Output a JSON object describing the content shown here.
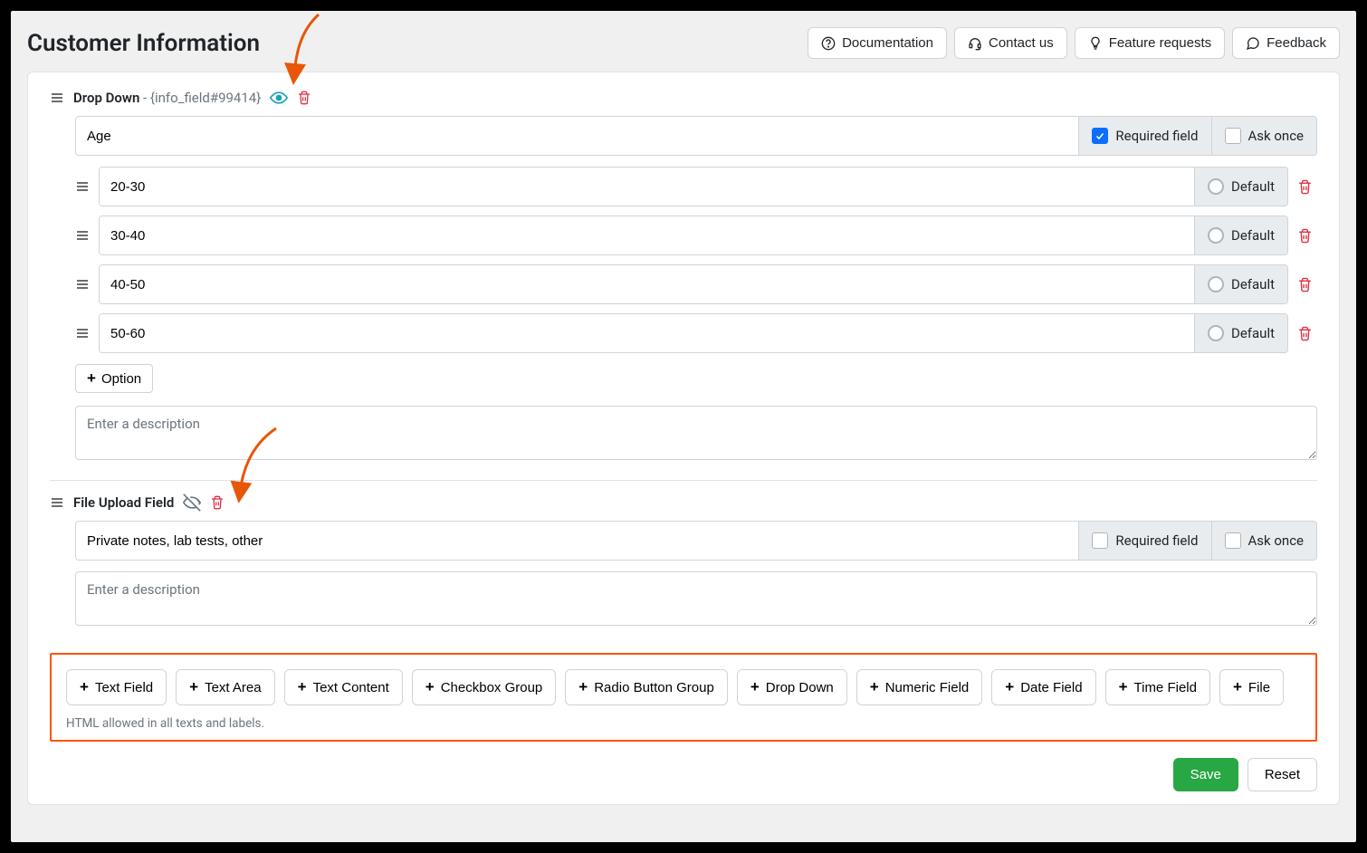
{
  "page_title": "Customer Information",
  "header_actions": {
    "documentation": "Documentation",
    "contact_us": "Contact us",
    "feature_requests": "Feature requests",
    "feedback": "Feedback"
  },
  "fields": {
    "dropdown": {
      "type_label": "Drop Down",
      "tag": " - {info_field#99414}",
      "name_value": "Age",
      "required_label": "Required field",
      "required_checked": true,
      "askonce_label": "Ask once",
      "askonce_checked": false,
      "options": [
        {
          "value": "20-30",
          "default_label": "Default"
        },
        {
          "value": "30-40",
          "default_label": "Default"
        },
        {
          "value": "40-50",
          "default_label": "Default"
        },
        {
          "value": "50-60",
          "default_label": "Default"
        }
      ],
      "add_option_label": "Option",
      "description_placeholder": "Enter a description"
    },
    "fileupload": {
      "type_label": "File Upload Field",
      "name_value": "Private notes, lab tests, other",
      "required_label": "Required field",
      "required_checked": false,
      "askonce_label": "Ask once",
      "askonce_checked": false,
      "description_placeholder": "Enter a description"
    }
  },
  "add_field": {
    "buttons": [
      "Text Field",
      "Text Area",
      "Text Content",
      "Checkbox Group",
      "Radio Button Group",
      "Drop Down",
      "Numeric Field",
      "Date Field",
      "Time Field",
      "File"
    ],
    "hint": "HTML allowed in all texts and labels."
  },
  "footer": {
    "save": "Save",
    "reset": "Reset"
  }
}
